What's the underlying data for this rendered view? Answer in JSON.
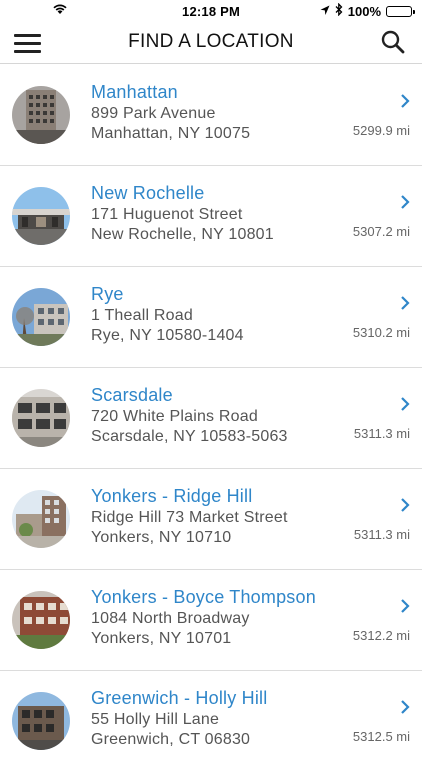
{
  "status": {
    "time": "12:18 PM",
    "battery": "100%",
    "battery_level": 1.0
  },
  "header": {
    "title": "FIND A LOCATION",
    "menu_icon": "hamburger-menu-icon",
    "search_icon": "search-icon"
  },
  "colors": {
    "accent": "#2f86c9",
    "text_secondary": "#555555",
    "battery": "#4cd964"
  },
  "locations": [
    {
      "name": "Manhattan",
      "street": "899 Park Avenue",
      "city": "Manhattan, NY 10075",
      "distance": "5299.9 mi"
    },
    {
      "name": "New Rochelle",
      "street": "171 Huguenot Street",
      "city": "New Rochelle, NY 10801",
      "distance": "5307.2 mi"
    },
    {
      "name": "Rye",
      "street": "1 Theall Road",
      "city": "Rye, NY 10580-1404",
      "distance": "5310.2 mi"
    },
    {
      "name": "Scarsdale",
      "street": "720 White Plains Road",
      "city": "Scarsdale, NY 10583-5063",
      "distance": "5311.3 mi"
    },
    {
      "name": "Yonkers - Ridge Hill",
      "street": "Ridge Hill 73 Market Street",
      "city": "Yonkers, NY 10710",
      "distance": "5311.3 mi"
    },
    {
      "name": "Yonkers - Boyce Thompson",
      "street": "1084 North Broadway",
      "city": "Yonkers, NY 10701",
      "distance": "5312.2 mi"
    },
    {
      "name": "Greenwich - Holly Hill",
      "street": "55 Holly Hill Lane",
      "city": "Greenwich, CT 06830",
      "distance": "5312.5 mi"
    }
  ]
}
